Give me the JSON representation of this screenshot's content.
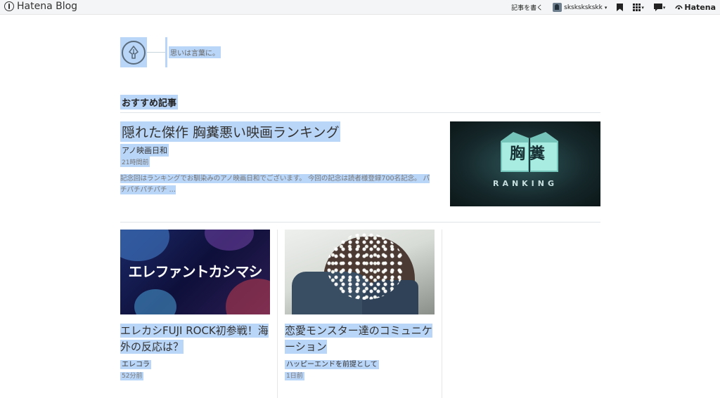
{
  "topbar": {
    "brand": "Hatena Blog",
    "write_label": "記事を書く",
    "username": "skskskskskk",
    "hatena_label": "Hatena"
  },
  "blog": {
    "tagline": "思いは言葉に。"
  },
  "section": {
    "title": "おすすめ記事"
  },
  "featured": {
    "title": "隠れた傑作 胸糞悪い映画ランキング",
    "blog_name": "アノ映画日和",
    "time": "21時間前",
    "excerpt": "記念回はランキングでお馴染みのアノ映画日和でございます。 今回の記念は読者様登録700名記念。 パチパチパチパチ …",
    "thumb_kanji": "胸糞",
    "thumb_text": "RANKING"
  },
  "cards": [
    {
      "title": "エレカシFUJI ROCK初参戦！海外の反応は？",
      "blog_name": "エレコラ",
      "time": "52分前",
      "thumb_text": "エレファントカシマシ"
    },
    {
      "title": "恋愛モンスター達のコミュニケーション",
      "blog_name": "ハッピーエンドを前提として",
      "time": "1日前"
    }
  ]
}
